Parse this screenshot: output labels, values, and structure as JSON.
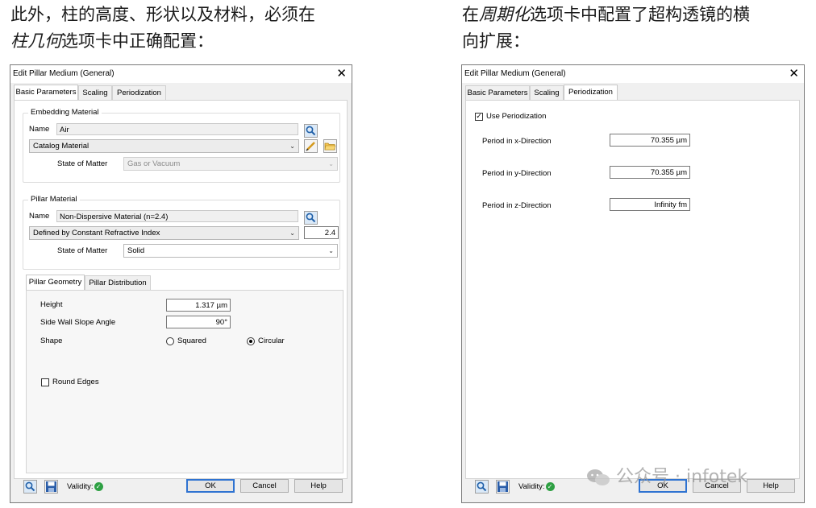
{
  "captions": {
    "left_line1": "此外，柱的高度、形状以及材料，必须在",
    "left_line2_em": "柱几何",
    "left_line2_rest": "选项卡中正确配置：",
    "right_line1_pre": "在",
    "right_line1_em": "周期化",
    "right_line1_rest": "选项卡中配置了超构透镜的横",
    "right_line2": "向扩展："
  },
  "dialog_left": {
    "title": "Edit Pillar Medium (General)",
    "tabs": [
      "Basic Parameters",
      "Scaling",
      "Periodization"
    ],
    "active_tab": "Basic Parameters",
    "embedding": {
      "group_title": "Embedding Material",
      "name_label": "Name",
      "name_value": "Air",
      "catalog_select": "Catalog Material",
      "state_label": "State of Matter",
      "state_value": "Gas or Vacuum"
    },
    "pillar": {
      "group_title": "Pillar Material",
      "name_label": "Name",
      "name_value": "Non-Dispersive Material (n=2.4)",
      "method_select": "Defined by Constant Refractive Index",
      "index_value": "2.4",
      "state_label": "State of Matter",
      "state_value": "Solid"
    },
    "subtabs": [
      "Pillar Geometry",
      "Pillar Distribution"
    ],
    "active_subtab": "Pillar Geometry",
    "geometry": {
      "height_label": "Height",
      "height_value": "1.317 µm",
      "slope_label": "Side Wall Slope Angle",
      "slope_value": "90°",
      "shape_label": "Shape",
      "shape_options": [
        "Squared",
        "Circular"
      ],
      "shape_selected": "Circular",
      "round_edges_label": "Round Edges",
      "round_edges_checked": false
    },
    "footer": {
      "validity_label": "Validity:",
      "ok": "OK",
      "cancel": "Cancel",
      "help": "Help"
    }
  },
  "dialog_right": {
    "title": "Edit Pillar Medium (General)",
    "tabs": [
      "Basic Parameters",
      "Scaling",
      "Periodization"
    ],
    "active_tab": "Periodization",
    "use_periodization_label": "Use Periodization",
    "use_periodization_checked": true,
    "period_x_label": "Period in x-Direction",
    "period_x_value": "70.355 µm",
    "period_y_label": "Period in y-Direction",
    "period_y_value": "70.355 µm",
    "period_z_label": "Period in z-Direction",
    "period_z_value": "Infinity fm",
    "footer": {
      "validity_label": "Validity:",
      "ok": "OK",
      "cancel": "Cancel",
      "help": "Help"
    }
  },
  "watermark": "公众号 · infotek",
  "colors": {
    "ok_border": "#2f73d1",
    "validity_green": "#2ea043",
    "dialog_bg": "#f0f0f0"
  }
}
